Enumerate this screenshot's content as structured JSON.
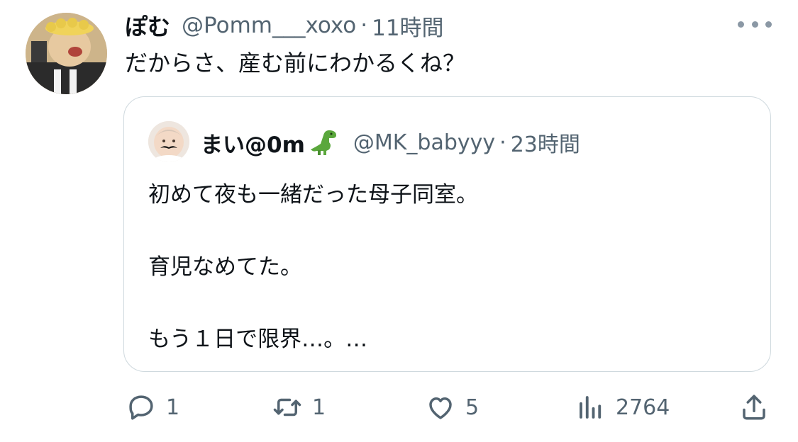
{
  "tweet": {
    "name": "ぽむ",
    "handle": "@Pomm___xoxo",
    "separator": "·",
    "time": "11時間",
    "text": "だからさ、産む前にわかるくね？"
  },
  "quote": {
    "name": "まい@0m",
    "emoji_icon": "dinosaur-emoji",
    "handle": "@MK_babyyy",
    "separator": "·",
    "time": "23時間",
    "lines": [
      "初めて夜も一緒だった母子同室。",
      "育児なめてた。",
      "もう１日で限界…。…"
    ]
  },
  "actions": {
    "reply": {
      "icon": "reply-icon",
      "count": "1"
    },
    "retweet": {
      "icon": "retweet-icon",
      "count": "1"
    },
    "like": {
      "icon": "heart-icon",
      "count": "5"
    },
    "views": {
      "icon": "analytics-icon",
      "count": "2764"
    },
    "share": {
      "icon": "share-icon"
    }
  },
  "colors": {
    "text": "#0f1419",
    "secondary": "#536471",
    "border": "#cfd9de",
    "more_dots": "#8b98a5"
  }
}
